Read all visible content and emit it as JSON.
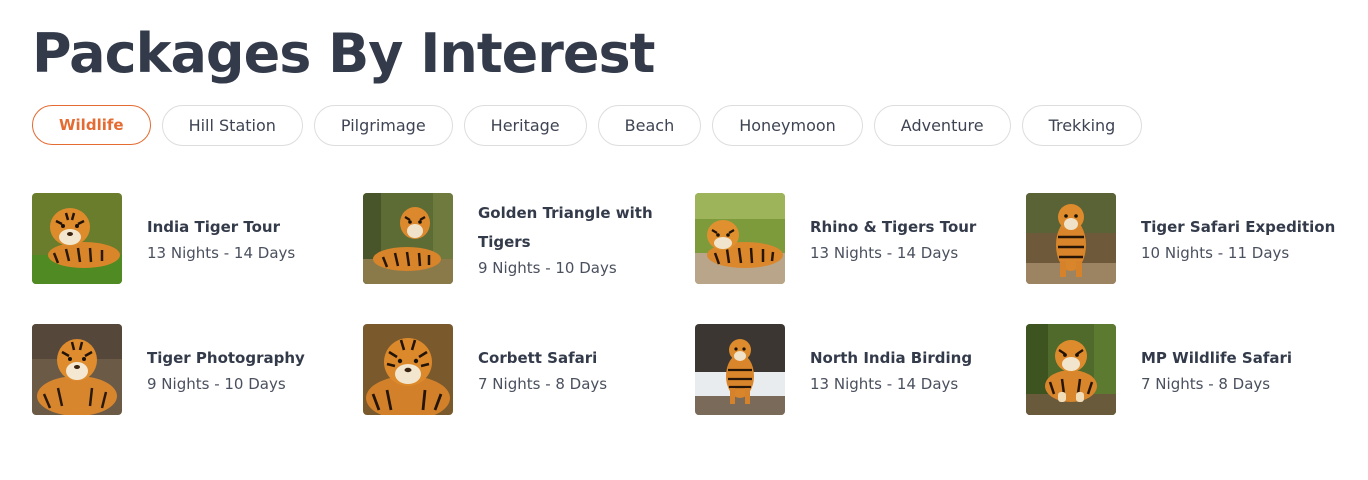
{
  "section": {
    "title": "Packages By Interest"
  },
  "tabs": [
    {
      "label": "Wildlife",
      "active": true
    },
    {
      "label": "Hill Station",
      "active": false
    },
    {
      "label": "Pilgrimage",
      "active": false
    },
    {
      "label": "Heritage",
      "active": false
    },
    {
      "label": "Beach",
      "active": false
    },
    {
      "label": "Honeymoon",
      "active": false
    },
    {
      "label": "Adventure",
      "active": false
    },
    {
      "label": "Trekking",
      "active": false
    }
  ],
  "packages": [
    {
      "title": "India Tiger Tour",
      "duration": "13 Nights - 14 Days",
      "image": "tiger-lying-grass-photo"
    },
    {
      "title": "Golden Triangle with Tigers",
      "duration": "9 Nights - 10 Days",
      "image": "tiger-resting-forest-photo"
    },
    {
      "title": "Rhino & Tigers Tour",
      "duration": "13 Nights - 14 Days",
      "image": "tiger-lying-ground-photo"
    },
    {
      "title": "Tiger Safari Expedition",
      "duration": "10 Nights - 11 Days",
      "image": "tiger-walking-photo"
    },
    {
      "title": "Tiger Photography",
      "duration": "9 Nights - 10 Days",
      "image": "tiger-portrait-photo"
    },
    {
      "title": "Corbett Safari",
      "duration": "7 Nights - 8 Days",
      "image": "tiger-closeup-photo"
    },
    {
      "title": "North India Birding",
      "duration": "13 Nights - 14 Days",
      "image": "tiger-snow-photo"
    },
    {
      "title": "MP Wildlife Safari",
      "duration": "7 Nights - 8 Days",
      "image": "tiger-sitting-jungle-photo"
    }
  ],
  "colors": {
    "accent": "#e46b31",
    "text": "#333a4a",
    "border": "#dddddd"
  }
}
